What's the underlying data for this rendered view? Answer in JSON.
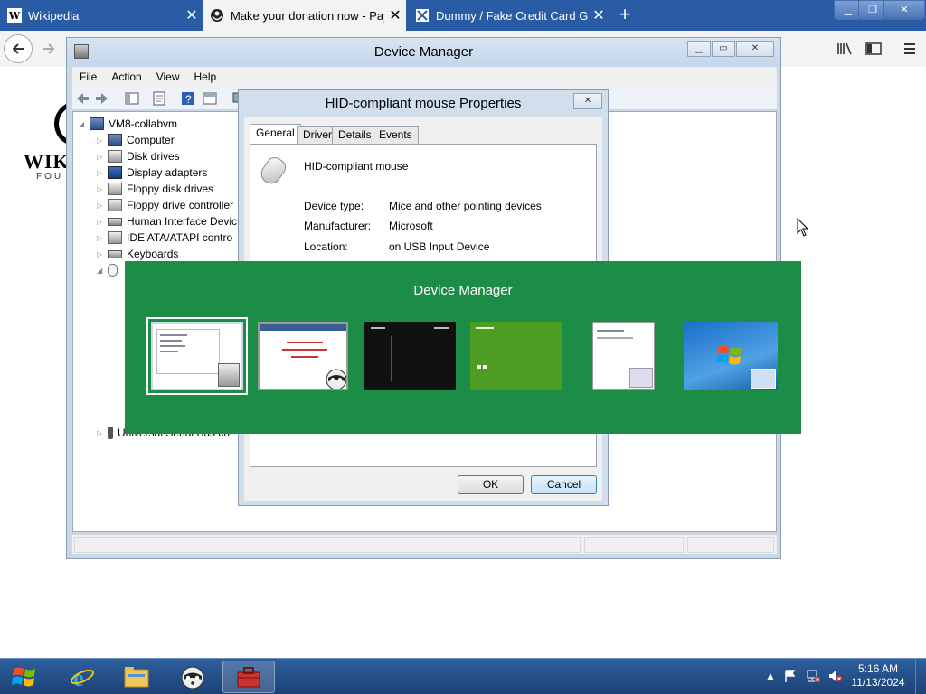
{
  "browser": {
    "tabs": [
      {
        "label": "Wikipedia",
        "favicon": "W"
      },
      {
        "label": "Make your donation now - Pay",
        "favicon": "wikimedia-icon"
      },
      {
        "label": "Dummy / Fake Credit Card Gen",
        "favicon": "card-generator-icon"
      }
    ],
    "new_tab": "+",
    "window_controls": [
      "minimize",
      "restore",
      "close"
    ]
  },
  "wiki_page": {
    "logo_word": "WIKI",
    "logo_sub": "FOU"
  },
  "device_manager": {
    "title": "Device Manager",
    "menu": [
      "File",
      "Action",
      "View",
      "Help"
    ],
    "tree_root": "VM8-collabvm",
    "tree_items": [
      "Computer",
      "Disk drives",
      "Display adapters",
      "Floppy disk drives",
      "Floppy drive controller",
      "Human Interface Devic",
      "IDE ATA/ATAPI contro",
      "Keyboards",
      "Universal Serial Bus co"
    ]
  },
  "properties": {
    "title": "HID-compliant mouse Properties",
    "tabs": [
      "General",
      "Driver",
      "Details",
      "Events"
    ],
    "device_name": "HID-compliant mouse",
    "fields": [
      {
        "label": "Device type:",
        "value": "Mice and other pointing devices"
      },
      {
        "label": "Manufacturer:",
        "value": "Microsoft"
      },
      {
        "label": "Location:",
        "value": "on USB Input Device"
      }
    ],
    "ok": "OK",
    "cancel": "Cancel"
  },
  "switcher": {
    "title": "Device Manager"
  },
  "taskbar": {
    "time": "5:16 AM",
    "date": "11/13/2024"
  },
  "colors": {
    "browser_tabbar": "#2a5ba5",
    "switcher_bg": "#1b8d46",
    "taskbar": "#1c4276"
  }
}
